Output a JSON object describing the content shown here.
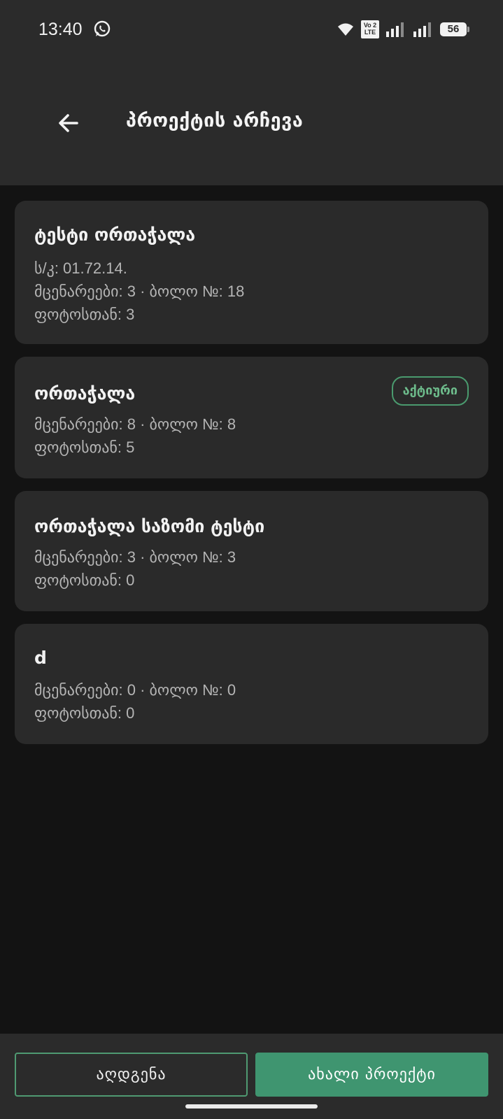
{
  "status_bar": {
    "time": "13:40",
    "battery": "56",
    "volte": "Vo 2 LTE",
    "icons": [
      "whatsapp-icon",
      "wifi-icon",
      "volte-icon",
      "signal-icon",
      "signal-icon",
      "battery-icon"
    ]
  },
  "header": {
    "title": "პროექტის არჩევა",
    "back_icon": "arrow-left-icon"
  },
  "projects": [
    {
      "name": "ტესტი ორთაჭალა",
      "lines": [
        "ს/კ: 01.72.14.",
        "მცენარეები: 3 · ბოლო №: 18",
        "ფოტოსთან: 3"
      ]
    },
    {
      "name": "ორთაჭალა",
      "badge": "აქტიური",
      "lines": [
        "მცენარეები: 8 · ბოლო №: 8",
        "ფოტოსთან: 5"
      ]
    },
    {
      "name": "ორთაჭალა საზომი ტესტი",
      "lines": [
        "მცენარეები: 3 · ბოლო №: 3",
        "ფოტოსთან: 0"
      ]
    },
    {
      "name": "d",
      "lines": [
        "მცენარეები: 0 · ბოლო №: 0",
        "ფოტოსთან: 0"
      ]
    }
  ],
  "footer": {
    "restore_label": "აღდგენა",
    "new_project_label": "ახალი პროექტი"
  },
  "colors": {
    "accent": "#3f9570",
    "background": "#131313",
    "surface": "#2a2a2a",
    "badge": "#6dbb8b"
  }
}
